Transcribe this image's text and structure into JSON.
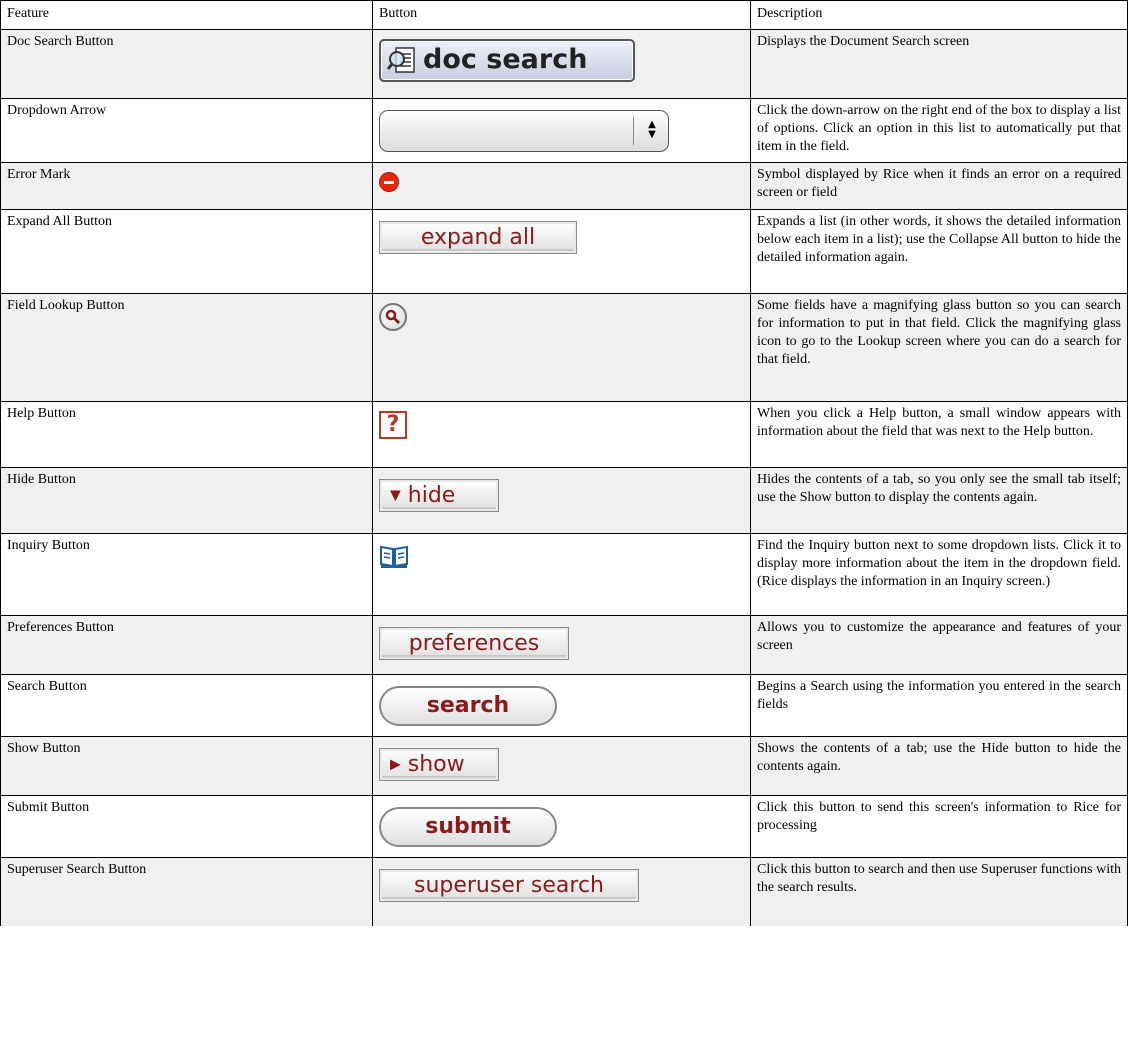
{
  "headers": [
    "Feature",
    "Button",
    "Description"
  ],
  "rows": [
    {
      "feature": "Doc Search Button",
      "button_text": "doc search",
      "button_icon": "doc-search-icon",
      "description": "Displays the Document Search screen"
    },
    {
      "feature": "Dropdown Arrow",
      "button_text": "",
      "button_icon": "dropdown-arrow-icon",
      "description": "Click the down-arrow on the right end of the box to display a list of options. Click an option in this list to automatically put that item in the field."
    },
    {
      "feature": "Error Mark",
      "button_text": "",
      "button_icon": "error-icon",
      "description": "Symbol displayed by Rice when it finds an error on a required screen or field"
    },
    {
      "feature": "Expand All Button",
      "button_text": "expand all",
      "button_icon": "",
      "description": "Expands a list (in other words, it shows the detailed information below each item in a list); use the Collapse All button to hide the detailed information again."
    },
    {
      "feature": "Field Lookup Button",
      "button_text": "",
      "button_icon": "magnifying-glass-icon",
      "description": "Some fields have a magnifying glass button so you can search for information to put in that field. Click the magnifying glass icon to go to the Lookup screen where you can do a search for that field."
    },
    {
      "feature": "Help Button",
      "button_text": "?",
      "button_icon": "help-icon",
      "description": "When you click a Help button, a small window appears with information about the field that was next to the Help button."
    },
    {
      "feature": "Hide Button",
      "button_text": "hide",
      "button_icon": "triangle-down-icon",
      "description": "Hides the contents of a tab, so you only see the small tab itself; use the Show button to display the contents again."
    },
    {
      "feature": "Inquiry Button",
      "button_text": "",
      "button_icon": "book-icon",
      "description": "Find the Inquiry button next to some dropdown lists. Click it to display more information about the item in the dropdown field. (Rice displays the information in an Inquiry screen.)"
    },
    {
      "feature": "Preferences Button",
      "button_text": "preferences",
      "button_icon": "",
      "description": "Allows you to customize the appearance and features of your screen"
    },
    {
      "feature": "Search Button",
      "button_text": "search",
      "button_icon": "",
      "description": "Begins a Search using the information you entered in the search fields"
    },
    {
      "feature": "Show Button",
      "button_text": "show",
      "button_icon": "triangle-right-icon",
      "description": "Shows the contents of a tab; use the Hide button to hide the contents again."
    },
    {
      "feature": "Submit Button",
      "button_text": "submit",
      "button_icon": "",
      "description": "Click this button to send this screen's information to Rice for processing"
    },
    {
      "feature": "Superuser Search Button",
      "button_text": "superuser search",
      "button_icon": "",
      "description": "Click this button to search and then use Superuser functions with the search results."
    }
  ],
  "colors": {
    "accent_text": "#8b1a1a",
    "error": "#e8260c",
    "row_shade": "#f0f0f0"
  }
}
